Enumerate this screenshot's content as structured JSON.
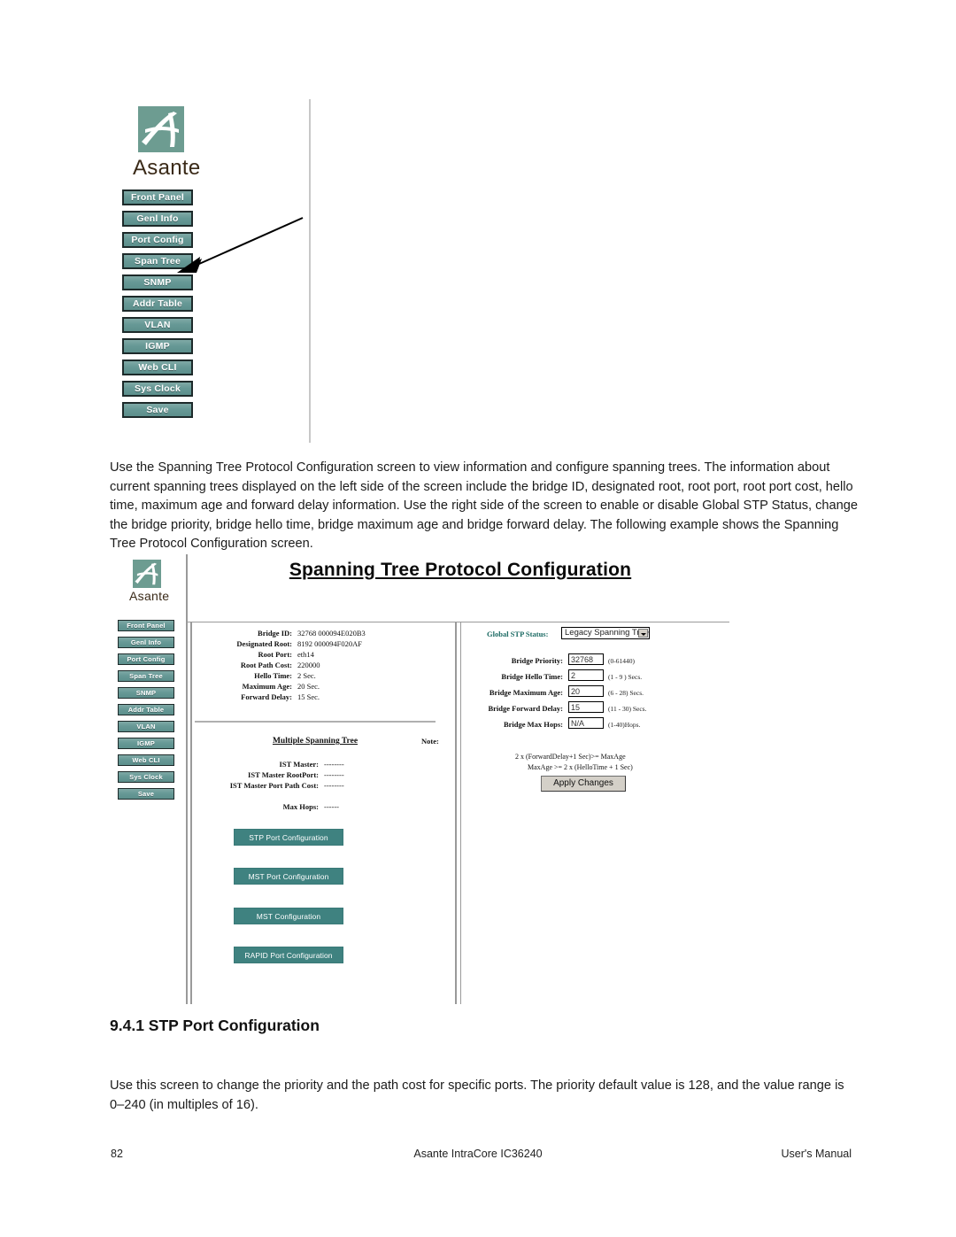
{
  "page": {
    "number": "82",
    "center": "Asante IntraCore IC36240",
    "right": "User's Manual"
  },
  "brand": {
    "name": "Asante"
  },
  "top_nav": {
    "items": [
      {
        "label": "Front Panel"
      },
      {
        "label": "Genl Info"
      },
      {
        "label": "Port Config"
      },
      {
        "label": "Span Tree"
      },
      {
        "label": "SNMP"
      },
      {
        "label": "Addr Table"
      },
      {
        "label": "VLAN"
      },
      {
        "label": "IGMP"
      },
      {
        "label": "Web CLI"
      },
      {
        "label": "Sys Clock"
      },
      {
        "label": "Save"
      }
    ],
    "callout_target": "Span Tree"
  },
  "intro_paragraph": "Use the Spanning Tree Protocol Configuration screen to view information and configure spanning trees. The information about current spanning trees displayed on the left side of the screen include the bridge ID, designated root, root port, root port cost, hello time, maximum age and forward delay information. Use the right side of the screen to enable or disable Global STP Status, change the bridge priority, bridge hello time, bridge maximum age and bridge forward delay. The following example shows the Spanning Tree Protocol Configuration screen.",
  "figure": {
    "title": "Spanning Tree Protocol Configuration",
    "nav": {
      "items": [
        {
          "label": "Front Panel"
        },
        {
          "label": "Genl Info"
        },
        {
          "label": "Port Config"
        },
        {
          "label": "Span Tree"
        },
        {
          "label": "SNMP"
        },
        {
          "label": "Addr Table"
        },
        {
          "label": "VLAN"
        },
        {
          "label": "IGMP"
        },
        {
          "label": "Web CLI"
        },
        {
          "label": "Sys Clock"
        },
        {
          "label": "Save"
        }
      ]
    },
    "left_panel": {
      "status_rows": [
        {
          "label": "Bridge ID:",
          "value": "32768 000094E020B3"
        },
        {
          "label": "Designated Root:",
          "value": "8192 000094F020AF"
        },
        {
          "label": "Root Port:",
          "value": "eth14"
        },
        {
          "label": "Root Path Cost:",
          "value": "220000"
        },
        {
          "label": "Hello Time:",
          "value": "2 Sec."
        },
        {
          "label": "Maximum Age:",
          "value": "20 Sec."
        },
        {
          "label": "Forward Delay:",
          "value": "15 Sec."
        }
      ],
      "mst_heading": "Multiple Spanning Tree",
      "mst_rows": [
        {
          "label": "IST Master:",
          "value": "--------"
        },
        {
          "label": "IST Master RootPort:",
          "value": "--------"
        },
        {
          "label": "IST Master Port Path Cost:",
          "value": "--------"
        }
      ],
      "max_hops": {
        "label": "Max Hops:",
        "value": "------"
      },
      "buttons": [
        {
          "label": "STP Port Configuration"
        },
        {
          "label": "MST Port Configuration"
        },
        {
          "label": "MST Configuration"
        },
        {
          "label": "RAPID Port Configuration"
        }
      ]
    },
    "right_panel": {
      "global_status": {
        "label": "Global STP Status:",
        "value": "Legacy Spanning Tree",
        "options": [
          "Legacy Spanning Tree"
        ]
      },
      "fields": [
        {
          "label": "Bridge Priority:",
          "value": "32768",
          "hint": "(0-61440)"
        },
        {
          "label": "Bridge Hello Time:",
          "value": "2",
          "hint": "(1 - 9 ) Secs."
        },
        {
          "label": "Bridge Maximum Age:",
          "value": "20",
          "hint": "(6 - 28) Secs."
        },
        {
          "label": "Bridge Forward Delay:",
          "value": "15",
          "hint": "(11 - 30) Secs."
        },
        {
          "label": "Bridge Max Hops:",
          "value": "N/A",
          "hint": "(1-40)Hops."
        }
      ],
      "note_label": "Note:",
      "note_lines": [
        "2 x (ForwardDelay+1 Sec)>= MaxAge",
        "MaxAge >= 2 x (HelloTime + 1 Sec)"
      ],
      "apply_label": "Apply Changes"
    }
  },
  "section": {
    "heading": "9.4.1 STP Port Configuration",
    "body": "Use this screen to change the priority and the path cost for specific ports. The priority default value is 128, and the value range is 0–240 (in multiples of 16)."
  },
  "colors": {
    "teal_button": "#679996",
    "teal_action": "#3f8280",
    "logo_green": "#6d9c91",
    "status_label": "#1b6a63"
  }
}
